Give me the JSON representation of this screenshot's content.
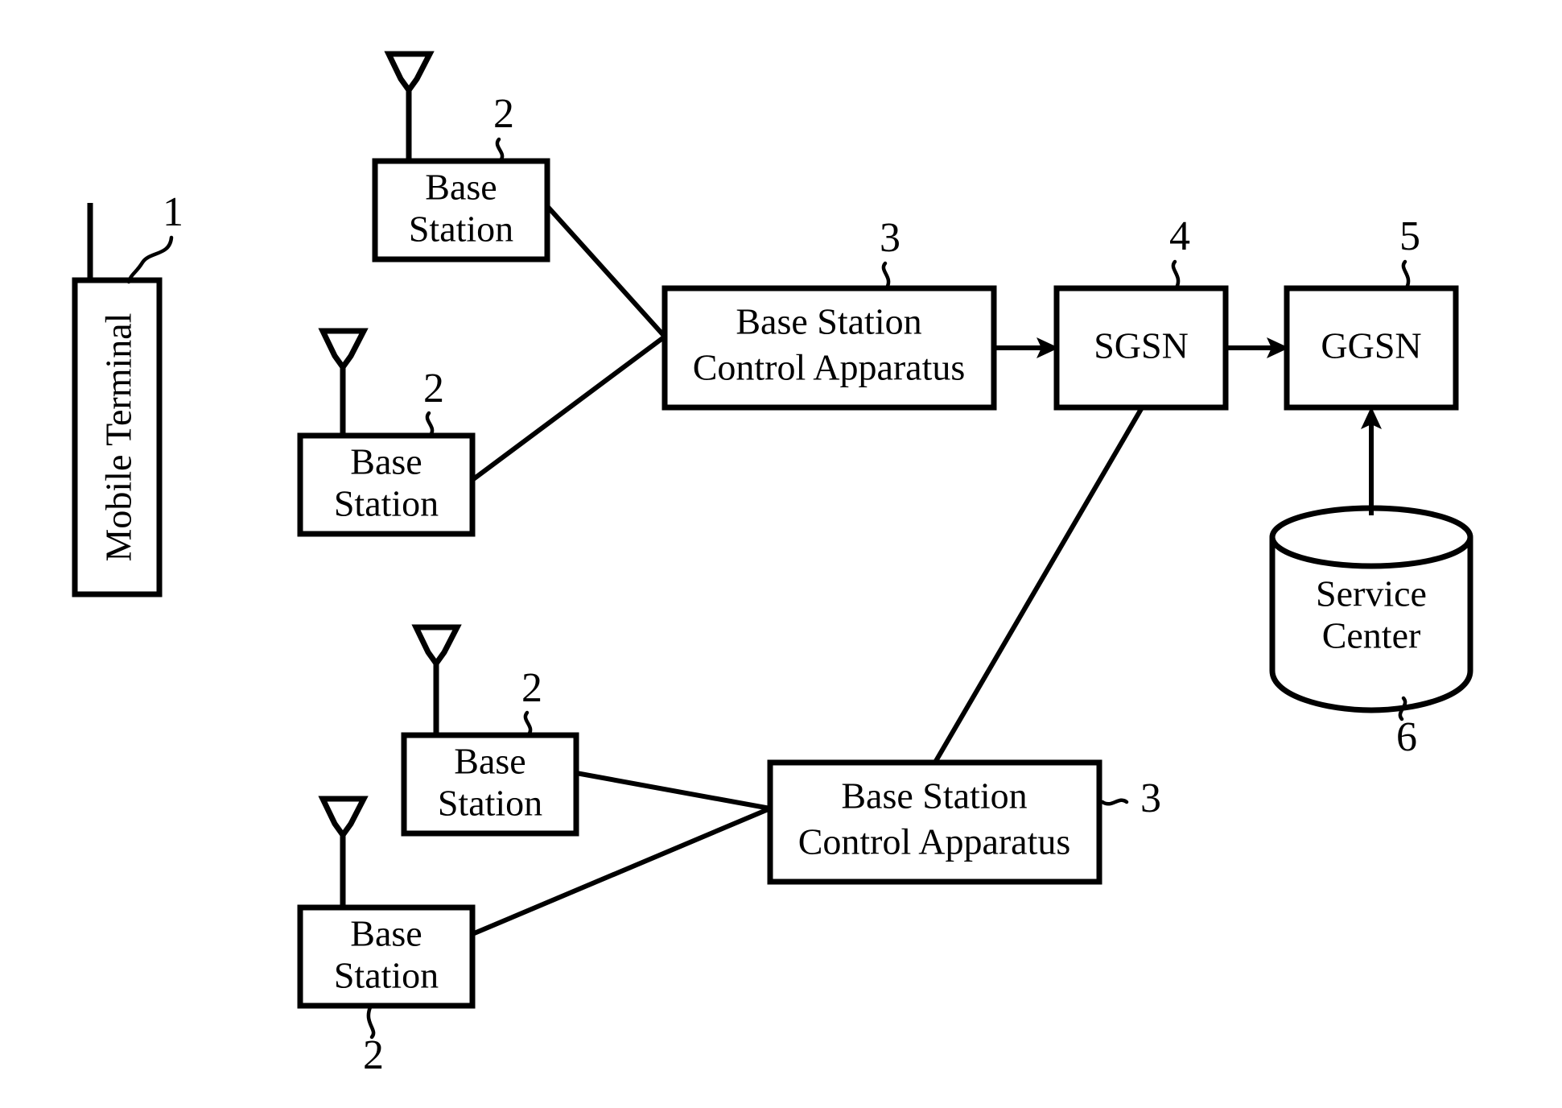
{
  "figure": {
    "type": "patent-network-diagram",
    "background_color": "#ffffff",
    "line_color": "#000000"
  },
  "nodes": {
    "mobile_terminal": {
      "label": "Mobile Terminal",
      "ref": "1",
      "shape": "vertical-rectangle",
      "orientation": "rotated-text-90"
    },
    "base_station_1": {
      "label_line1": "Base",
      "label_line2": "Station",
      "ref": "2"
    },
    "base_station_2": {
      "label_line1": "Base",
      "label_line2": "Station",
      "ref": "2"
    },
    "base_station_3": {
      "label_line1": "Base",
      "label_line2": "Station",
      "ref": "2"
    },
    "base_station_4": {
      "label_line1": "Base",
      "label_line2": "Station",
      "ref": "2"
    },
    "bsc_upper": {
      "label_line1": "Base Station",
      "label_line2": "Control Apparatus",
      "ref": "3"
    },
    "bsc_lower": {
      "label_line1": "Base Station",
      "label_line2": "Control Apparatus",
      "ref": "3"
    },
    "sgsn": {
      "label": "SGSN",
      "ref": "4"
    },
    "ggsn": {
      "label": "GGSN",
      "ref": "5"
    },
    "service_center": {
      "label_line1": "Service",
      "label_line2": "Center",
      "ref": "6",
      "shape": "cylinder"
    }
  },
  "connections": [
    {
      "from": "base_station_1",
      "to": "bsc_upper",
      "style": "plain-line"
    },
    {
      "from": "base_station_2",
      "to": "bsc_upper",
      "style": "plain-line"
    },
    {
      "from": "bsc_upper",
      "to": "sgsn",
      "style": "arrow"
    },
    {
      "from": "sgsn",
      "to": "ggsn",
      "style": "arrow"
    },
    {
      "from": "service_center",
      "to": "ggsn",
      "style": "arrow"
    },
    {
      "from": "base_station_3",
      "to": "bsc_lower",
      "style": "plain-line"
    },
    {
      "from": "base_station_4",
      "to": "bsc_lower",
      "style": "plain-line"
    },
    {
      "from": "bsc_lower",
      "to": "sgsn",
      "style": "plain-line"
    }
  ]
}
